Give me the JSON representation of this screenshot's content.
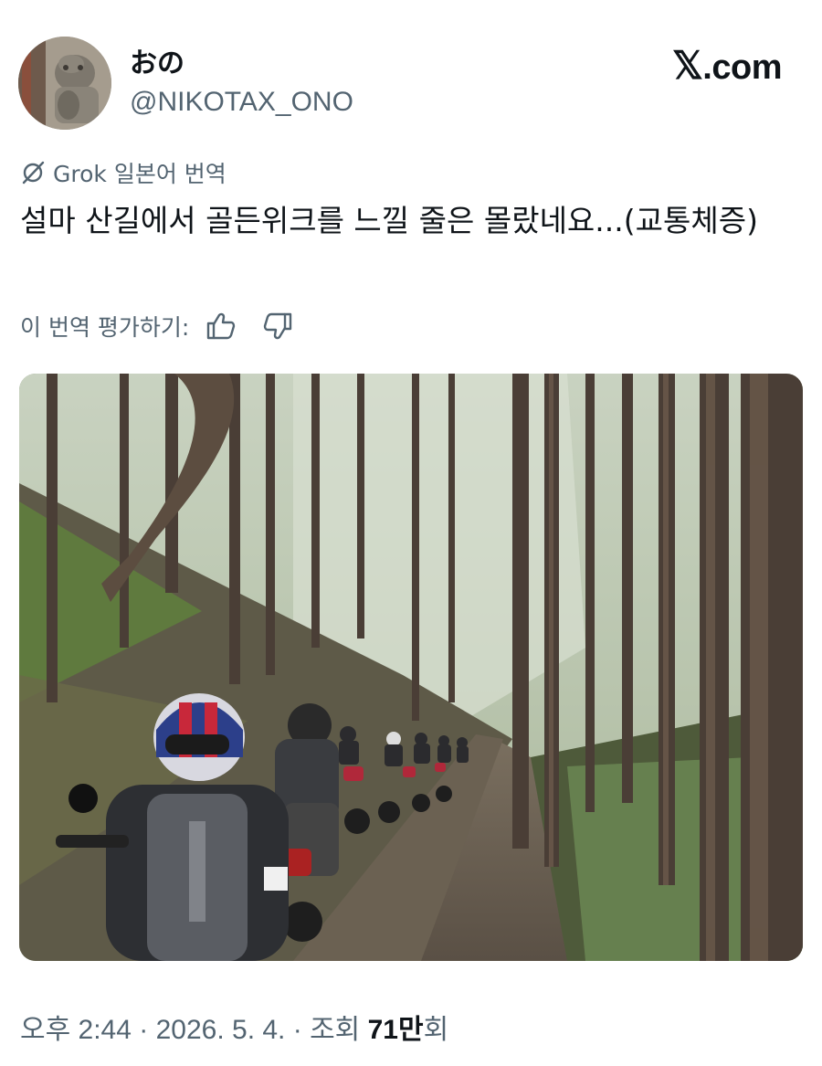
{
  "author": {
    "display_name": "おの",
    "handle": "@NIKOTAX_ONO"
  },
  "brand": {
    "logo_text": ".com",
    "logo_glyph": "𝕏"
  },
  "translation": {
    "label": "Grok 일본어 번역",
    "icon": "grok-slash-icon"
  },
  "tweet": {
    "text": "설마 산길에서 골든위크를 느낄 줄은 몰랐네요...(교통체증)"
  },
  "rating": {
    "label": "이 번역 평가하기:",
    "icons": [
      "thumbs-up-icon",
      "thumbs-down-icon"
    ]
  },
  "photo": {
    "description_icon": "forest-trail-motorcycles-image"
  },
  "meta": {
    "time": "오후 2:44",
    "sep1": " · ",
    "date": "2026. 5. 4.",
    "sep2": " · ",
    "views_label": "조회 ",
    "views_count": "71만",
    "views_suffix": "회"
  },
  "colors": {
    "text": "#0f1419",
    "secondary": "#536471"
  }
}
